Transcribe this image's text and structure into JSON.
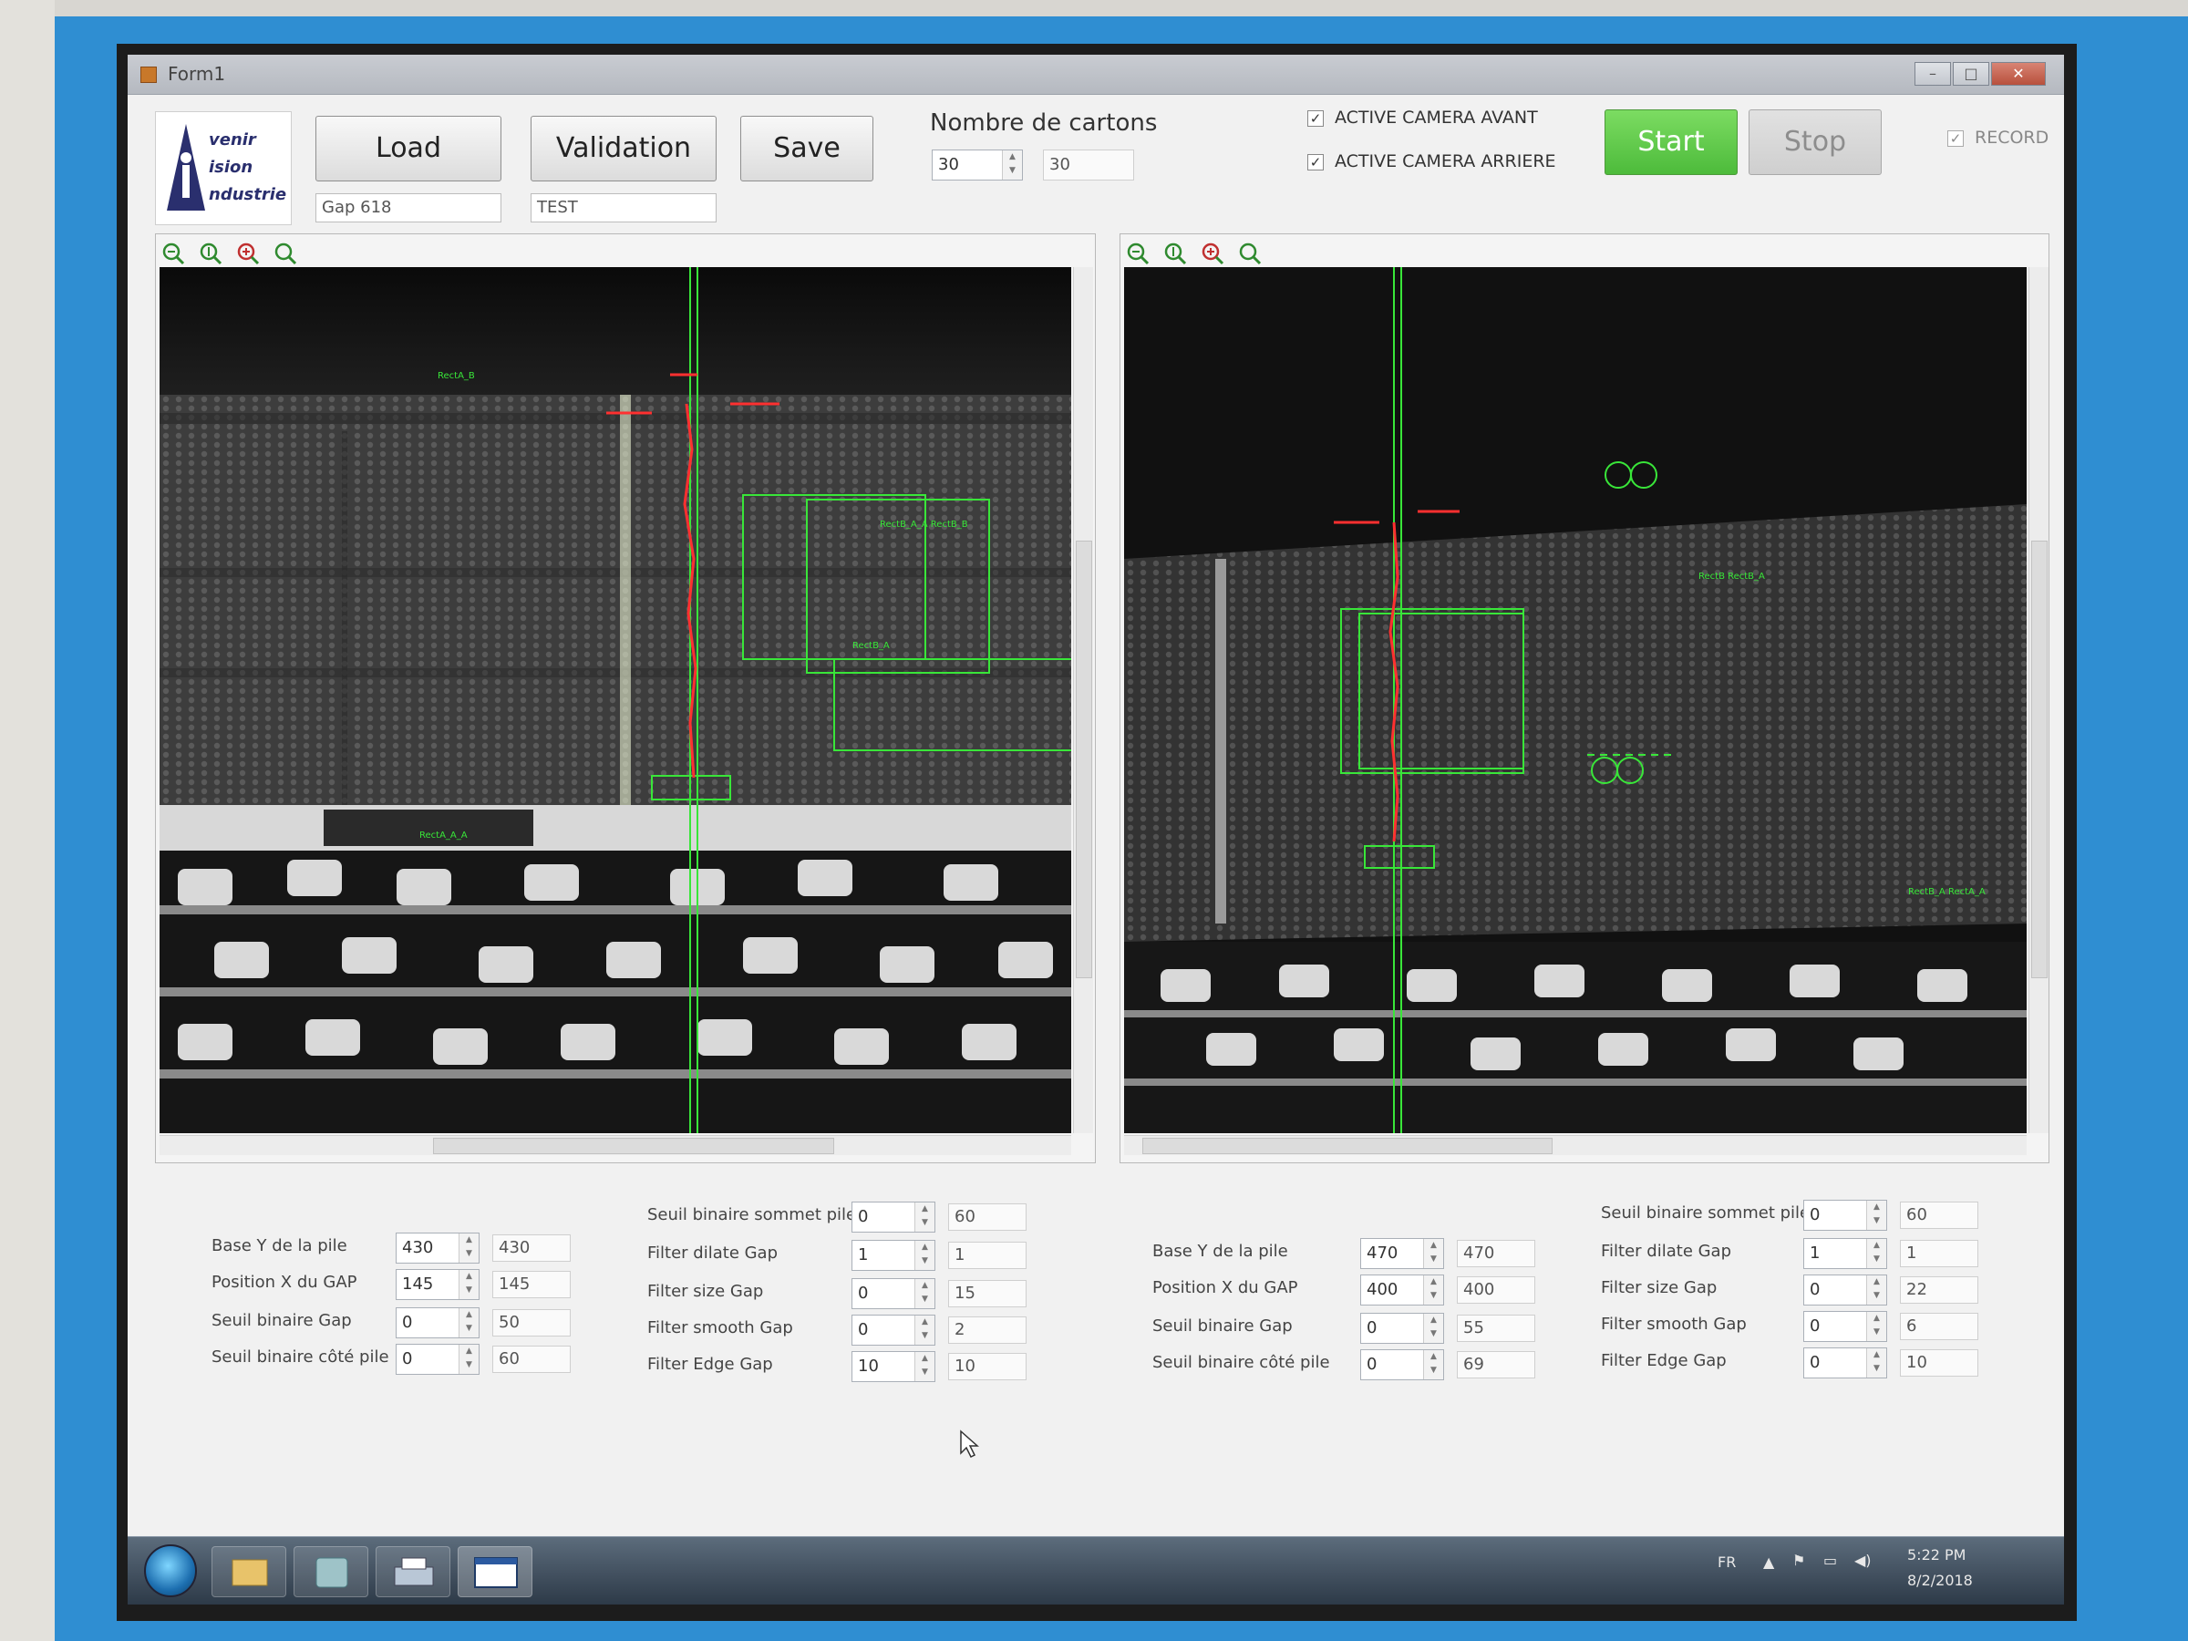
{
  "window": {
    "title": "Form1"
  },
  "logo": {
    "line1": "venir",
    "line2": "ision",
    "line3": "ndustrie"
  },
  "toolbar": {
    "load": "Load",
    "validation": "Validation",
    "save": "Save",
    "gap_value": "Gap 618",
    "test_value": "TEST",
    "nombre_label": "Nombre de cartons",
    "nombre_spin": "30",
    "nombre_value": "30",
    "camera_avant": "ACTIVE CAMERA AVANT",
    "camera_arriere": "ACTIVE CAMERA ARRIERE",
    "start": "Start",
    "stop": "Stop",
    "record": "RECORD",
    "check_mark": "✓"
  },
  "overlay_labels": {
    "left": {
      "a": "RectA_B",
      "b": "RectB_A_A RectB_B",
      "c": "RectB_A",
      "d": "RectA_A_A"
    },
    "right": {
      "a": "RectB RectB_A",
      "b": "RectB_A RectA_A"
    }
  },
  "params_left_a": [
    {
      "label": "Base Y de la pile",
      "spin": "430",
      "value": "430"
    },
    {
      "label": "Position X du GAP",
      "spin": "145",
      "value": "145"
    },
    {
      "label": "Seuil binaire Gap",
      "spin": "0",
      "value": "50"
    },
    {
      "label": "Seuil binaire côté pile",
      "spin": "0",
      "value": "60"
    }
  ],
  "params_left_b": [
    {
      "label": "Seuil binaire sommet pile",
      "spin": "0",
      "value": "60"
    },
    {
      "label": "Filter dilate Gap",
      "spin": "1",
      "value": "1"
    },
    {
      "label": "Filter size Gap",
      "spin": "0",
      "value": "15"
    },
    {
      "label": "Filter smooth Gap",
      "spin": "0",
      "value": "2"
    },
    {
      "label": "Filter Edge Gap",
      "spin": "10",
      "value": "10"
    }
  ],
  "params_right_a": [
    {
      "label": "Base Y de la pile",
      "spin": "470",
      "value": "470"
    },
    {
      "label": "Position X du GAP",
      "spin": "400",
      "value": "400"
    },
    {
      "label": "Seuil binaire Gap",
      "spin": "0",
      "value": "55"
    },
    {
      "label": "Seuil binaire côté pile",
      "spin": "0",
      "value": "69"
    }
  ],
  "params_right_b": [
    {
      "label": "Seuil binaire sommet pile",
      "spin": "0",
      "value": "60"
    },
    {
      "label": "Filter dilate Gap",
      "spin": "1",
      "value": "1"
    },
    {
      "label": "Filter size Gap",
      "spin": "0",
      "value": "22"
    },
    {
      "label": "Filter smooth Gap",
      "spin": "0",
      "value": "6"
    },
    {
      "label": "Filter Edge Gap",
      "spin": "0",
      "value": "10"
    }
  ],
  "taskbar": {
    "lang": "FR",
    "time": "5:22 PM",
    "date": "8/2/2018"
  },
  "colors": {
    "overlay_green": "#39e639",
    "overlay_red": "#ff3030",
    "start_green": "#5ccb45"
  }
}
